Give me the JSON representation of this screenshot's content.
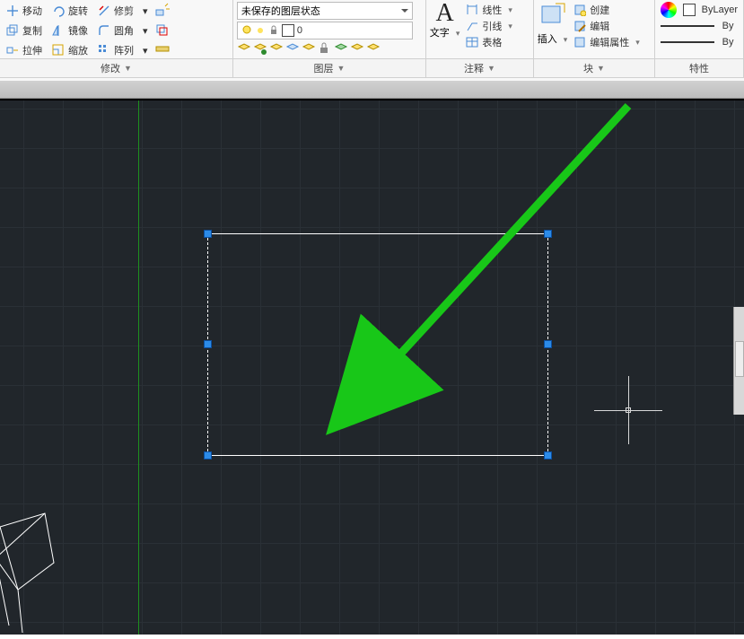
{
  "ribbon": {
    "modify": {
      "row1": [
        "移动",
        "旋转",
        "修剪"
      ],
      "row2": [
        "复制",
        "镜像",
        "圆角"
      ],
      "row3": [
        "拉伸",
        "缩放",
        "阵列"
      ],
      "label": "修改"
    },
    "layer": {
      "state_text": "未保存的图层状态",
      "current_layer": "0",
      "label": "图层"
    },
    "anno": {
      "big_letter": "A",
      "text_label": "文字",
      "r1": "线性",
      "r2": "引线",
      "r3": "表格",
      "label": "注释"
    },
    "block": {
      "insert_label": "插入",
      "r1": "创建",
      "r2": "编辑",
      "r3": "编辑属性",
      "label": "块"
    },
    "props": {
      "bylayer": "ByLayer",
      "by_partial": "By",
      "label": "特性"
    }
  }
}
